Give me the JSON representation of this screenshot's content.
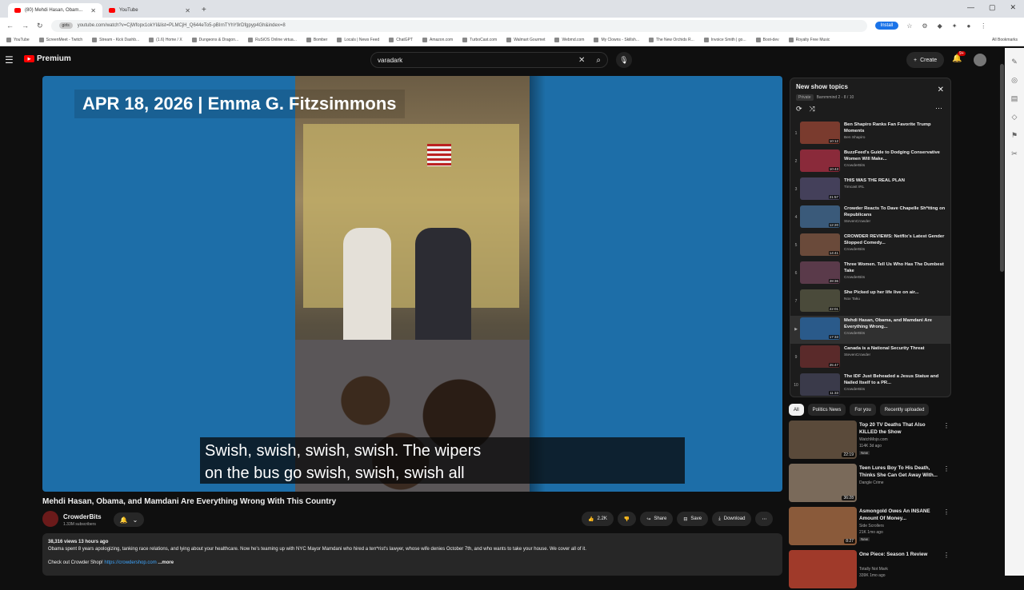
{
  "browser": {
    "tabs": [
      {
        "label": "(80) Mehdi Hasan, Obam...",
        "active": true
      },
      {
        "label": "YouTube",
        "active": false
      }
    ],
    "url": "youtube.com/watch?v=CjWfopx1okYI&list=PLMCjH_Q644eTo5-pBIrnTYhY9rDfgpyp4Gh&index=8",
    "site_chip": "girls",
    "install_label": "Install",
    "bookmarks": [
      "YouTube",
      "ScreenMeet - Twitch",
      "Stream - Kick Dashb...",
      "(1.6) Home / X",
      "Dungeons & Dragon...",
      "RuSiOS Online virtua...",
      "Bomber",
      "Locals | News Feed",
      "ChatGPT",
      "Amazon.com",
      "TurboCast.com",
      "Walmart Gourmet",
      "Webmd.com",
      "My Clowns - Skillsh...",
      "The New Orchids R...",
      "Invoice Smith | go...",
      "Boot-dev",
      "Royalty Free Music"
    ],
    "all_bookmarks": "All Bookmarks"
  },
  "yt": {
    "brand": "Premium",
    "search_value": "varadark",
    "create_label": "Create",
    "notif_count": "9+"
  },
  "video": {
    "banner": "APR 18, 2026 | Emma G. Fitzsimmons",
    "caption_line1": "Swish, swish, swish, swish. The wipers",
    "caption_line2": "on the bus go swish, swish, swish all",
    "title": "Mehdi Hasan, Obama, and Mamdani Are Everything Wrong With This Country",
    "channel": "CrowderBits",
    "subscribers": "1.33M subscribers",
    "likes": "2.2K",
    "share_label": "Share",
    "save_label": "Save",
    "download_label": "Download",
    "stats": "38,316 views  13 hours ago",
    "description": "Obama spent 8 years apologizing, tanking race relations, and lying about your healthcare. Now he's teaming up with NYC Mayor Mamdani who hired a terr*rist's lawyer, whose wife denies October 7th, and who wants to take your house. We cover all of it.",
    "shop_text": "Check out Crowder Shop!",
    "shop_link": "https://crowdershop.com",
    "more_label": "...more"
  },
  "playlist": {
    "title": "New show topics",
    "privacy": "Private",
    "owner_progress": "Barnmmind 2 - 8 / 10",
    "items": [
      {
        "idx": "1",
        "title": "Ben Shapiro Ranks Fan Favorite Trump Moments",
        "channel": "Ben Shapiro",
        "duration": "10:12",
        "color": "#7a3b2e"
      },
      {
        "idx": "2",
        "title": "BuzzFeed's Guide to Dodging Conservative Women Will Make...",
        "channel": "CrowderBits",
        "duration": "10:43",
        "color": "#8a2a3a"
      },
      {
        "idx": "3",
        "title": "THIS WAS THE REAL PLAN",
        "channel": "Timcast IRL",
        "duration": "21:57",
        "color": "#44405a"
      },
      {
        "idx": "4",
        "title": "Crowder Reacts To Dave Chapelle Sh*tting on Republicans",
        "channel": "StevenCrowder",
        "duration": "12:20",
        "color": "#3a5a7a"
      },
      {
        "idx": "5",
        "title": "CROWDER REVIEWS: Netflix's Latest Gender Slopped Comedy...",
        "channel": "CrowderBits",
        "duration": "14:41",
        "color": "#6a4a3a"
      },
      {
        "idx": "6",
        "title": "Three Women. Tell Us Who Has The Dumbest Take",
        "channel": "CrowderBits",
        "duration": "28:36",
        "color": "#5a3a4a"
      },
      {
        "idx": "7",
        "title": "She Picked up her life live on air...",
        "channel": "Nox Taku",
        "duration": "22:01",
        "color": "#4a4a3a"
      },
      {
        "idx": "",
        "title": "Mehdi Hasan, Obama, and Mamdani Are Everything Wrong...",
        "channel": "CrowderBits",
        "duration": "17:33",
        "color": "#2a5a8a",
        "current": true
      },
      {
        "idx": "9",
        "title": "Canada is a National Security Threat",
        "channel": "StevenCrowder",
        "duration": "25:47",
        "color": "#5a2a2a"
      },
      {
        "idx": "10",
        "title": "The IDF Just Beheaded a Jesus Statue and Nailed Itself to a PR...",
        "channel": "CrowderBits",
        "duration": "11:33",
        "color": "#3a3a4a"
      }
    ]
  },
  "chips": [
    "All",
    "Politics News",
    "For you",
    "Recently uploaded"
  ],
  "recommendations": [
    {
      "title": "Top 20 TV Deaths That Also KILLED the Show",
      "channel": "WatchMojo.com",
      "meta": "114K  3d ago",
      "badge": "New",
      "duration": "22:19",
      "color": "#5a4a3a"
    },
    {
      "title": "Teen Lures Boy To His Death, Thinks She Can Get Away With...",
      "channel": "Dangle Crime",
      "meta": "",
      "badge": "",
      "duration": "36:28",
      "color": "#7a6a5a"
    },
    {
      "title": "Asmongold Owes An INSANE Amount Of Money...",
      "channel": "Side Scrollers",
      "meta": "21K  1mo ago",
      "badge": "New",
      "duration": "8:27",
      "color": "#8a5a3a"
    },
    {
      "title": "One Piece: Season 1 Review",
      "channel": "Totally Not Mark",
      "meta": "339K  1mo ago",
      "badge": "",
      "duration": "",
      "color": "#a03a2a"
    }
  ]
}
